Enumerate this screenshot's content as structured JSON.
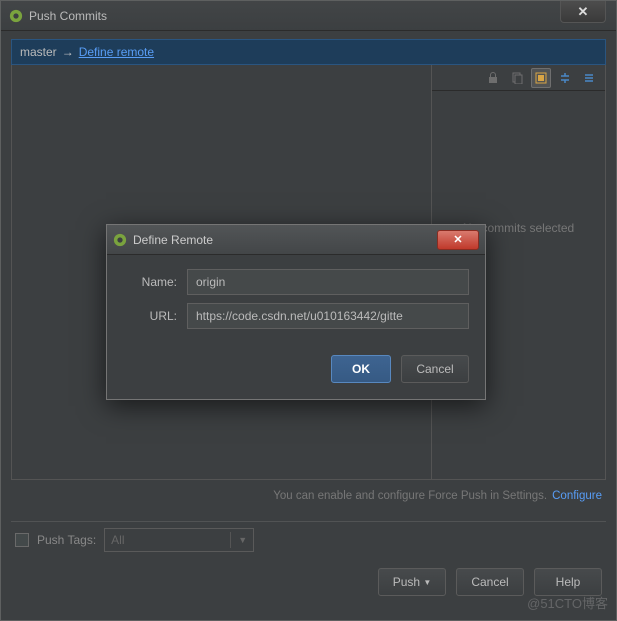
{
  "window": {
    "title": "Push Commits"
  },
  "branch": {
    "local": "master",
    "arrow": "→",
    "remote_link": "Define remote"
  },
  "right": {
    "no_commits": "No commits selected"
  },
  "hint": {
    "text": "You can enable and configure Force Push in Settings.",
    "link": "Configure"
  },
  "options": {
    "push_tags_label": "Push Tags:",
    "push_tags_underline": "T",
    "tags_selected": "All"
  },
  "buttons": {
    "push": "Push",
    "cancel": "Cancel",
    "help": "Help"
  },
  "modal": {
    "title": "Define Remote",
    "name_label": "Name:",
    "name_value": "origin",
    "url_label": "URL:",
    "url_value": "https://code.csdn.net/u010163442/gitte",
    "ok": "OK",
    "cancel": "Cancel"
  },
  "watermark": "@51CTO博客"
}
